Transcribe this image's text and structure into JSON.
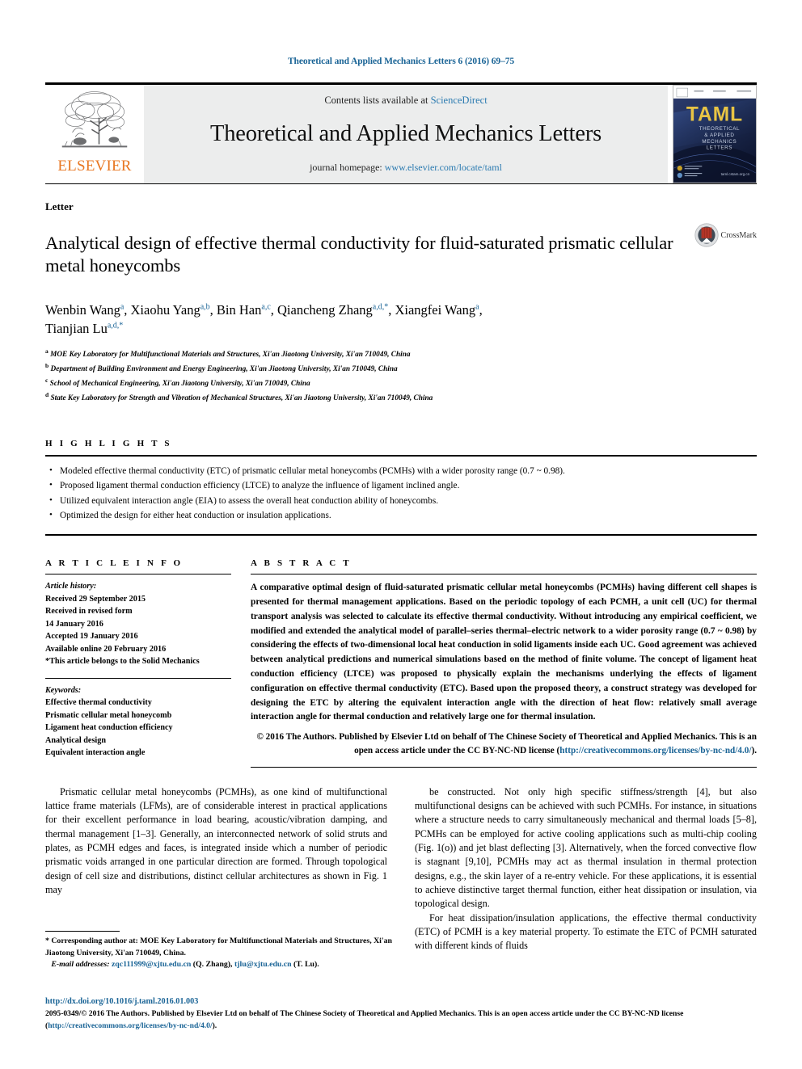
{
  "running_head": "Theoretical and Applied Mechanics Letters 6 (2016) 69–75",
  "masthead": {
    "contents_prefix": "Contents lists available at ",
    "contents_link": "ScienceDirect",
    "journal_name": "Theoretical and Applied Mechanics Letters",
    "homepage_prefix": "journal homepage: ",
    "homepage_url": "www.elsevier.com/locate/taml",
    "publisher_wordmark": "ELSEVIER",
    "cover_title": "TAML",
    "cover_subtitle_lines": [
      "THEORETICAL",
      "& APPLIED",
      "MECHANICS",
      "LETTERS"
    ],
    "cover_footer_url": "taml.cstam.org.cn"
  },
  "article": {
    "type": "Letter",
    "title": "Analytical design of effective thermal conductivity for fluid-saturated prismatic cellular metal honeycombs",
    "crossmark_label": "CrossMark",
    "authors_line1": "Wenbin Wang a, Xiaohu Yang a,b, Bin Han a,c, Qiancheng Zhang a,d,*, Xiangfei Wang a,",
    "authors_line2": "Tianjian Lu a,d,*",
    "authors": [
      {
        "name": "Wenbin Wang",
        "sup": "a"
      },
      {
        "name": "Xiaohu Yang",
        "sup": "a,b"
      },
      {
        "name": "Bin Han",
        "sup": "a,c"
      },
      {
        "name": "Qiancheng Zhang",
        "sup": "a,d,*"
      },
      {
        "name": "Xiangfei Wang",
        "sup": "a"
      },
      {
        "name": "Tianjian Lu",
        "sup": "a,d,*"
      }
    ],
    "affiliations": [
      {
        "marker": "a",
        "text": "MOE Key Laboratory for Multifunctional Materials and Structures, Xi'an Jiaotong University, Xi'an 710049, China"
      },
      {
        "marker": "b",
        "text": "Department of Building Environment and Energy Engineering, Xi'an Jiaotong University, Xi'an 710049, China"
      },
      {
        "marker": "c",
        "text": "School of Mechanical Engineering, Xi'an Jiaotong University, Xi'an 710049, China"
      },
      {
        "marker": "d",
        "text": "State Key Laboratory for Strength and Vibration of Mechanical Structures, Xi'an Jiaotong University, Xi'an 710049, China"
      }
    ]
  },
  "highlights": {
    "label": "H I G H L I G H T S",
    "items": [
      "Modeled effective thermal conductivity (ETC) of prismatic cellular metal honeycombs (PCMHs) with a wider porosity range (0.7 ~ 0.98).",
      "Proposed ligament thermal conduction efficiency (LTCE) to analyze the influence of ligament inclined angle.",
      "Utilized equivalent interaction angle (EIA) to assess the overall heat conduction ability of honeycombs.",
      "Optimized the design for either heat conduction or insulation applications."
    ]
  },
  "article_info": {
    "label": "A R T I C L E   I N F O",
    "history_label": "Article history:",
    "history": [
      "Received 29 September 2015",
      "Received in revised form",
      "14 January 2016",
      "Accepted 19 January 2016",
      "Available online 20 February 2016",
      "*This article belongs to the Solid Mechanics"
    ],
    "keywords_label": "Keywords:",
    "keywords": [
      "Effective thermal conductivity",
      "Prismatic cellular metal honeycomb",
      "Ligament heat conduction efficiency",
      "Analytical design",
      "Equivalent interaction angle"
    ]
  },
  "abstract": {
    "label": "A B S T R A C T",
    "text": "A comparative optimal design of fluid-saturated prismatic cellular metal honeycombs (PCMHs) having different cell shapes is presented for thermal management applications. Based on the periodic topology of each PCMH, a unit cell (UC) for thermal transport analysis was selected to calculate its effective thermal conductivity. Without introducing any empirical coefficient, we modified and extended the analytical model of parallel–series thermal–electric network to a wider porosity range (0.7 ~ 0.98) by considering the effects of two-dimensional local heat conduction in solid ligaments inside each UC. Good agreement was achieved between analytical predictions and numerical simulations based on the method of finite volume. The concept of ligament heat conduction efficiency (LTCE) was proposed to physically explain the mechanisms underlying the effects of ligament configuration on effective thermal conductivity (ETC). Based upon the proposed theory, a construct strategy was developed for designing the ETC by altering the equivalent interaction angle with the direction of heat flow: relatively small average interaction angle for thermal conduction and relatively large one for thermal insulation.",
    "copyright_text": "© 2016 The Authors. Published by Elsevier Ltd on behalf of The Chinese Society of Theoretical and Applied Mechanics. This is an open access article under the CC BY-NC-ND license (",
    "copyright_link": "http://creativecommons.org/licenses/by-nc-nd/4.0/",
    "copyright_suffix": ")."
  },
  "body": {
    "left_paragraph": "Prismatic cellular metal honeycombs (PCMHs), as one kind of multifunctional lattice frame materials (LFMs), are of considerable interest in practical applications for their excellent performance in load bearing, acoustic/vibration damping, and thermal management [1–3]. Generally, an interconnected network of solid struts and plates, as PCMH edges and faces, is integrated inside which a number of periodic prismatic voids arranged in one particular direction are formed. Through topological design of cell size and distributions, distinct cellular architectures as shown in Fig. 1 may",
    "right_paragraph_1": "be constructed. Not only high specific stiffness/strength [4], but also multifunctional designs can be achieved with such PCMHs. For instance, in situations where a structure needs to carry simultaneously mechanical and thermal loads [5–8], PCMHs can be employed for active cooling applications such as multi-chip cooling (Fig. 1(o)) and jet blast deflecting [3]. Alternatively, when the forced convective flow is stagnant [9,10], PCMHs may act as thermal insulation in thermal protection designs, e.g., the skin layer of a re-entry vehicle. For these applications, it is essential to achieve distinctive target thermal function, either heat dissipation or insulation, via topological design.",
    "right_paragraph_2": "For heat dissipation/insulation applications, the effective thermal conductivity (ETC) of PCMH is a key material property. To estimate the ETC of PCMH saturated with different kinds of fluids"
  },
  "footnotes": {
    "corresponding": "* Corresponding author at: MOE Key Laboratory for Multifunctional Materials and Structures, Xi'an Jiaotong University, Xi'an 710049, China.",
    "email_label": "E-mail addresses:",
    "email_1": "zqc111999@xjtu.edu.cn",
    "email_1_owner": "(Q. Zhang),",
    "email_2": "tjlu@xjtu.edu.cn",
    "email_2_owner": "(T. Lu)."
  },
  "bottom": {
    "doi": "http://dx.doi.org/10.1016/j.taml.2016.01.003",
    "issn_copyright": "2095-0349/© 2016 The Authors. Published by Elsevier Ltd on behalf of The Chinese Society of Theoretical and Applied Mechanics. This is an open access article under the CC BY-NC-ND license (",
    "license_link": "http://creativecommons.org/licenses/by-nc-nd/4.0/",
    "license_suffix": ")."
  },
  "colors": {
    "link_blue": "#1a6496",
    "elsevier_orange": "#E87722",
    "masthead_grey": "#eceded"
  }
}
